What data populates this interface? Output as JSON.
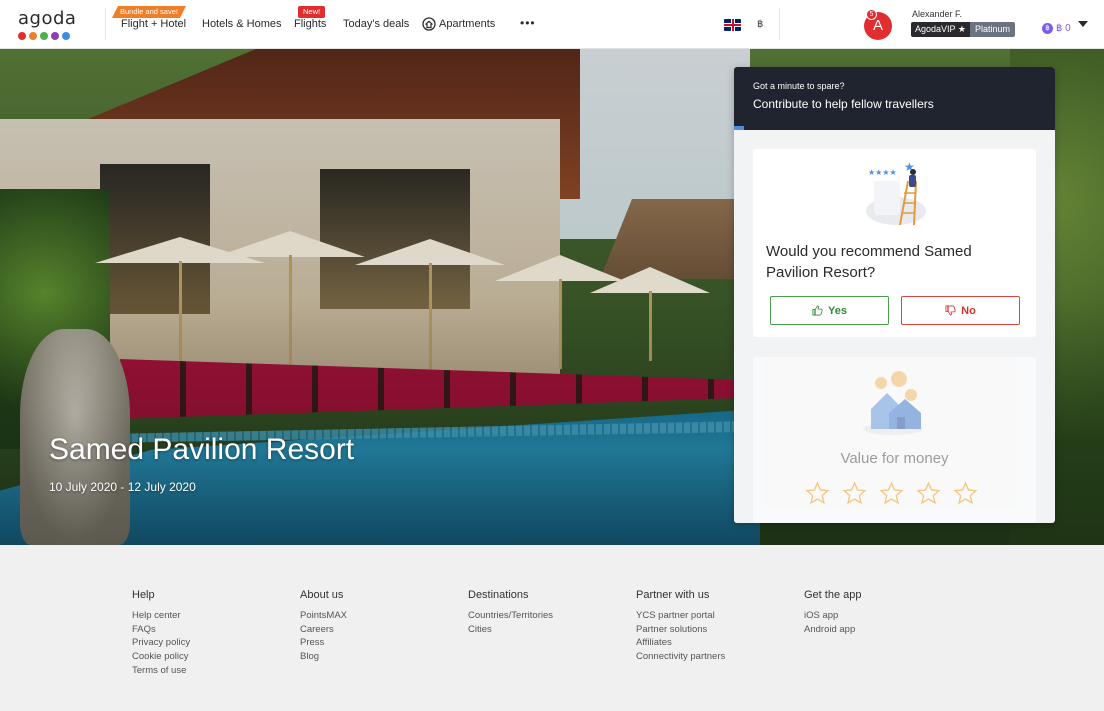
{
  "header": {
    "logo_text": "agoda",
    "logo_dots": [
      "#e12d2d",
      "#f07e26",
      "#4bb04b",
      "#8b3fb0",
      "#3a8ee0"
    ],
    "nav": [
      {
        "label": "Flight + Hotel",
        "badge": "Bundle and save!"
      },
      {
        "label": "Hotels & Homes"
      },
      {
        "label": "Flights",
        "badge": "New!"
      },
      {
        "label": "Today's deals"
      },
      {
        "label": "Apartments"
      },
      {
        "label": "•••"
      }
    ],
    "currency": "฿",
    "avatar_letter": "A",
    "notification_count": "5",
    "user_name": "Alexander F.",
    "vip_label": "AgodaVIP ★",
    "tier": "Platinum",
    "points_coin": "฿",
    "points": "฿ 0"
  },
  "hero": {
    "title": "Samed Pavilion Resort",
    "dates": "10 July 2020 - 12 July 2020"
  },
  "feedback": {
    "subtitle": "Got a minute to spare?",
    "title": "Contribute to help fellow travellers",
    "question": "Would you recommend Samed Pavilion Resort?",
    "yes_label": "Yes",
    "no_label": "No",
    "next_question": "Value for money",
    "star_count": 5,
    "colors": {
      "yes": "#2e8b35",
      "no": "#d9322b",
      "star": "#f5a623",
      "header": "#1f242e"
    }
  },
  "footer": {
    "columns": [
      {
        "title": "Help",
        "links": [
          "Help center",
          "FAQs",
          "Privacy policy",
          "Cookie policy",
          "Terms of use"
        ]
      },
      {
        "title": "About us",
        "links": [
          "PointsMAX",
          "Careers",
          "Press",
          "Blog"
        ]
      },
      {
        "title": "Destinations",
        "links": [
          "Countries/Territories",
          "Cities"
        ]
      },
      {
        "title": "Partner with us",
        "links": [
          "YCS partner portal",
          "Partner solutions",
          "Affiliates",
          "Connectivity partners"
        ]
      },
      {
        "title": "Get the app",
        "links": [
          "iOS app",
          "Android app"
        ]
      }
    ]
  }
}
